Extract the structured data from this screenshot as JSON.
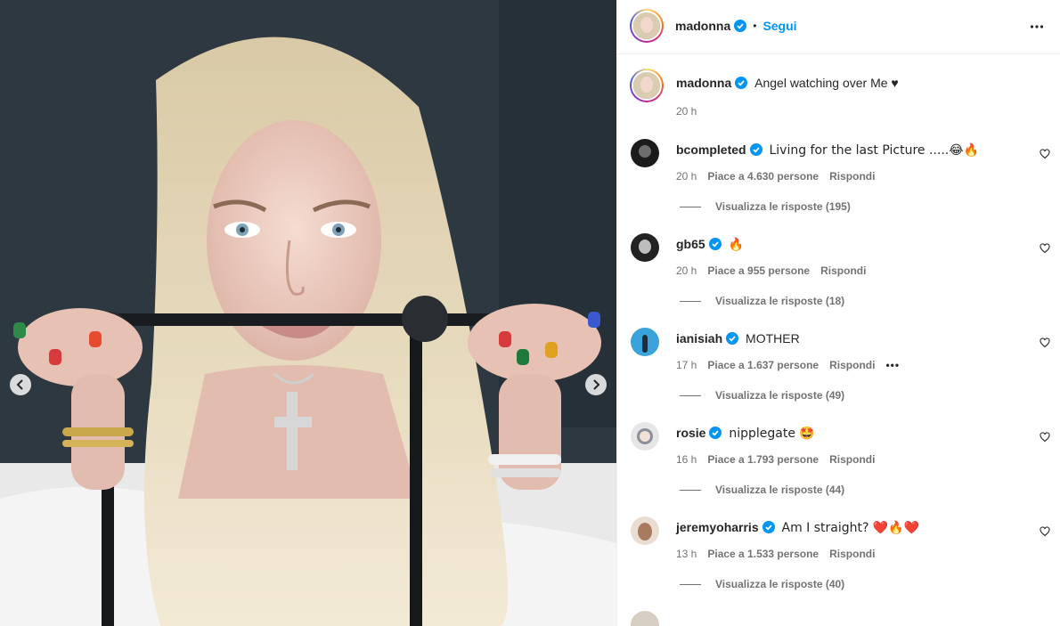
{
  "post": {
    "author": "madonna",
    "follow_label": "Segui",
    "separator": "•",
    "caption": "Angel watching over Me ♥",
    "caption_time": "20 h"
  },
  "comments": [
    {
      "user": "bcompleted",
      "text": "Living for the last Picture .....😂🔥",
      "time": "20 h",
      "likes": "Piace a 4.630 persone",
      "reply": "Rispondi",
      "replies": "Visualizza le risposte (195)"
    },
    {
      "user": "gb65",
      "text": "🔥",
      "time": "20 h",
      "likes": "Piace a 955 persone",
      "reply": "Rispondi",
      "replies": "Visualizza le risposte (18)"
    },
    {
      "user": "ianisiah",
      "text": "MOTHER",
      "time": "17 h",
      "likes": "Piace a 1.637 persone",
      "reply": "Rispondi",
      "more": "•••",
      "replies": "Visualizza le risposte (49)"
    },
    {
      "user": "rosie",
      "text": "nipplegate 🤩",
      "time": "16 h",
      "likes": "Piace a 1.793 persone",
      "reply": "Rispondi",
      "replies": "Visualizza le risposte (44)"
    },
    {
      "user": "jeremyoharris",
      "text": "Am I straight? ❤️🔥❤️",
      "time": "13 h",
      "likes": "Piace a 1.533 persone",
      "reply": "Rispondi",
      "replies": "Visualizza le risposte (40)"
    }
  ],
  "colors": {
    "accent": "#0095f6",
    "verified": "#0095f6",
    "meta": "#737373",
    "text": "#262626"
  },
  "icons": [
    "verified-badge-icon",
    "more-options-icon",
    "heart-icon",
    "chevron-left-icon",
    "chevron-right-icon"
  ]
}
